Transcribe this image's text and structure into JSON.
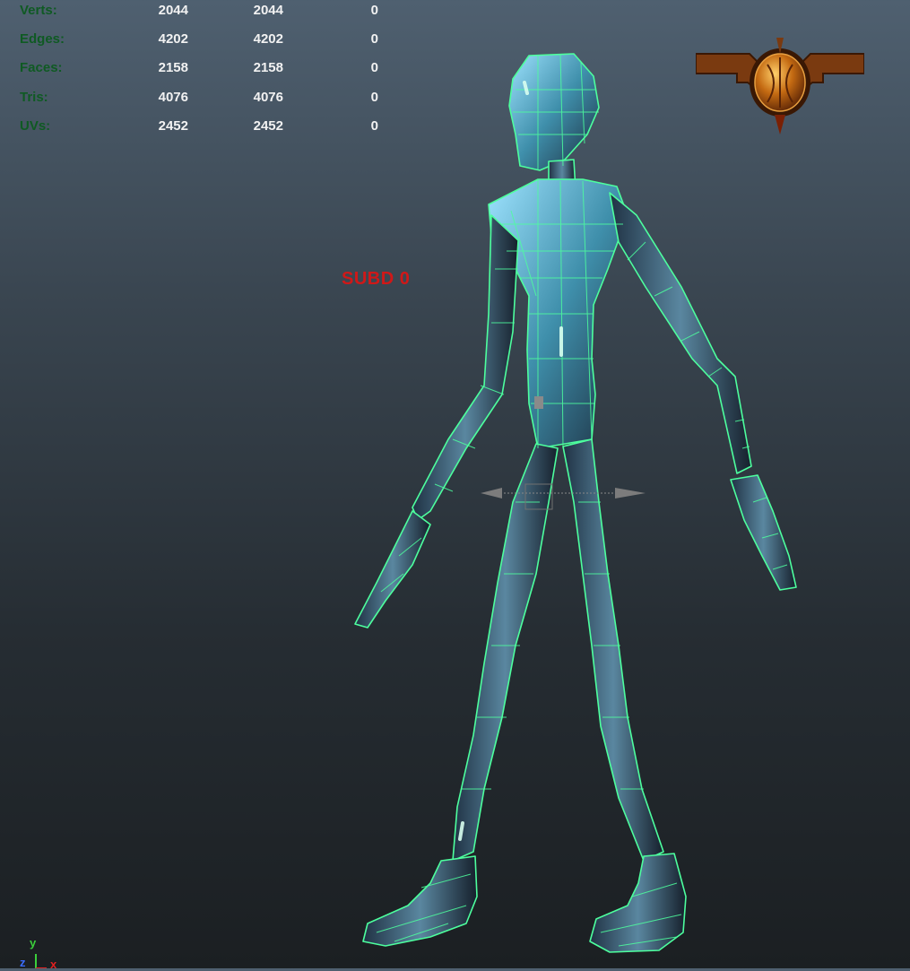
{
  "viewport": {
    "heads_up_display": {
      "rows": [
        {
          "label": "Verts:",
          "values": [
            "2044",
            "2044",
            "0"
          ]
        },
        {
          "label": "Edges:",
          "values": [
            "4202",
            "4202",
            "0"
          ]
        },
        {
          "label": "Faces:",
          "values": [
            "2158",
            "2158",
            "0"
          ]
        },
        {
          "label": "Tris:",
          "values": [
            "4076",
            "4076",
            "0"
          ]
        },
        {
          "label": "UVs:",
          "values": [
            "2452",
            "2452",
            "0"
          ]
        }
      ]
    },
    "annotation": {
      "text": "SUBD 0",
      "color": "#d01818"
    },
    "axis_indicator": {
      "y_label": "y",
      "z_label": "z",
      "x_label": "x"
    },
    "wireframe_color": "#4dff9e",
    "background_colors": [
      "#4f6070",
      "#1b1f22"
    ],
    "icons": {
      "logo": "winged-helmet-logo",
      "manipulator": "move-manipulator-icon",
      "axis": "view-axis-icon"
    }
  }
}
